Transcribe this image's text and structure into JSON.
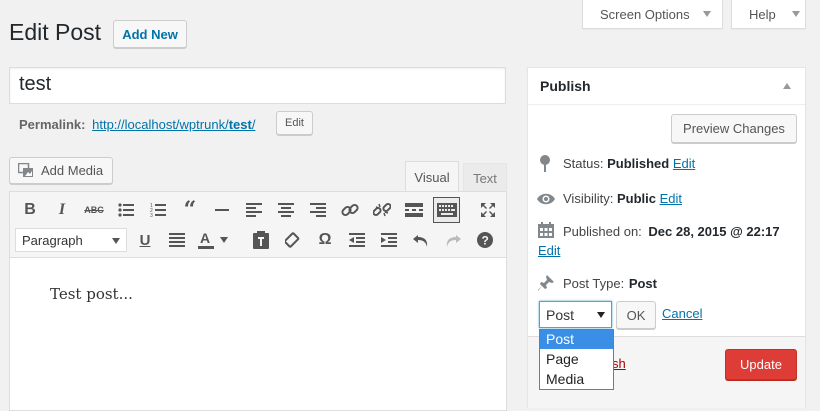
{
  "header": {
    "title": "Edit Post",
    "add_new": "Add New",
    "screen_options": "Screen Options",
    "help": "Help"
  },
  "post": {
    "title_value": "test",
    "permalink_label": "Permalink:",
    "permalink_url": "http://localhost/wptrunk/",
    "permalink_slug": "test",
    "permalink_trailing": "/",
    "permalink_edit": "Edit",
    "content": "Test post..."
  },
  "editor": {
    "add_media": "Add Media",
    "tab_visual": "Visual",
    "tab_text": "Text",
    "format_select": "Paragraph"
  },
  "publish": {
    "title": "Publish",
    "preview": "Preview Changes",
    "status_label": "Status:",
    "status_value": "Published",
    "visibility_label": "Visibility:",
    "visibility_value": "Public",
    "published_label": "Published on:",
    "published_value": "Dec 28, 2015 @ 22:17",
    "edit": "Edit",
    "post_type_label": "Post Type:",
    "post_type_value": "Post",
    "select_value": "Post",
    "options": [
      "Post",
      "Page",
      "Media"
    ],
    "ok": "OK",
    "cancel": "Cancel",
    "trash_partial": "sh",
    "update": "Update"
  },
  "colors": {
    "link": "#0073aa",
    "update": "#dd3d36",
    "selected_option": "#3a8ee6",
    "trash": "#a00"
  }
}
